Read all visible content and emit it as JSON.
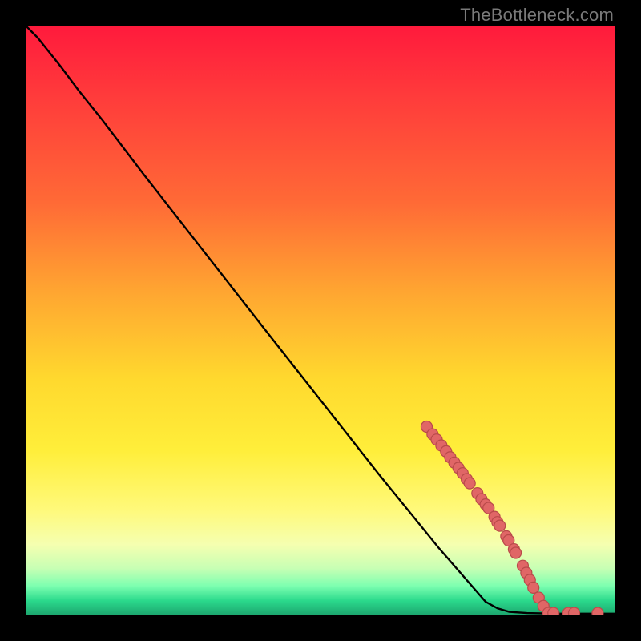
{
  "watermark": "TheBottleneck.com",
  "chart_data": {
    "type": "line",
    "title": "",
    "xlabel": "",
    "ylabel": "",
    "xlim": [
      0,
      1
    ],
    "ylim": [
      0,
      1
    ],
    "note": "Axes are unlabeled in the source image; x and y are normalized 0–1 within the plot frame. y=1 is the top edge, y=0 is the bottom edge.",
    "curve": [
      {
        "x": 0.0,
        "y": 1.0
      },
      {
        "x": 0.02,
        "y": 0.98
      },
      {
        "x": 0.04,
        "y": 0.955
      },
      {
        "x": 0.06,
        "y": 0.93
      },
      {
        "x": 0.09,
        "y": 0.89
      },
      {
        "x": 0.13,
        "y": 0.84
      },
      {
        "x": 0.2,
        "y": 0.748
      },
      {
        "x": 0.3,
        "y": 0.62
      },
      {
        "x": 0.4,
        "y": 0.492
      },
      {
        "x": 0.5,
        "y": 0.365
      },
      {
        "x": 0.6,
        "y": 0.238
      },
      {
        "x": 0.7,
        "y": 0.115
      },
      {
        "x": 0.78,
        "y": 0.023
      },
      {
        "x": 0.8,
        "y": 0.012
      },
      {
        "x": 0.82,
        "y": 0.006
      },
      {
        "x": 0.85,
        "y": 0.004
      },
      {
        "x": 0.9,
        "y": 0.003
      },
      {
        "x": 1.0,
        "y": 0.003
      }
    ],
    "markers": [
      {
        "x": 0.68,
        "y": 0.32
      },
      {
        "x": 0.69,
        "y": 0.307
      },
      {
        "x": 0.697,
        "y": 0.298
      },
      {
        "x": 0.705,
        "y": 0.288
      },
      {
        "x": 0.713,
        "y": 0.278
      },
      {
        "x": 0.72,
        "y": 0.268
      },
      {
        "x": 0.727,
        "y": 0.259
      },
      {
        "x": 0.734,
        "y": 0.25
      },
      {
        "x": 0.741,
        "y": 0.241
      },
      {
        "x": 0.748,
        "y": 0.231
      },
      {
        "x": 0.753,
        "y": 0.224
      },
      {
        "x": 0.766,
        "y": 0.207
      },
      {
        "x": 0.773,
        "y": 0.197
      },
      {
        "x": 0.78,
        "y": 0.188
      },
      {
        "x": 0.785,
        "y": 0.182
      },
      {
        "x": 0.795,
        "y": 0.167
      },
      {
        "x": 0.8,
        "y": 0.158
      },
      {
        "x": 0.804,
        "y": 0.152
      },
      {
        "x": 0.815,
        "y": 0.134
      },
      {
        "x": 0.819,
        "y": 0.127
      },
      {
        "x": 0.828,
        "y": 0.112
      },
      {
        "x": 0.831,
        "y": 0.106
      },
      {
        "x": 0.843,
        "y": 0.084
      },
      {
        "x": 0.849,
        "y": 0.072
      },
      {
        "x": 0.855,
        "y": 0.06
      },
      {
        "x": 0.861,
        "y": 0.047
      },
      {
        "x": 0.87,
        "y": 0.03
      },
      {
        "x": 0.878,
        "y": 0.016
      },
      {
        "x": 0.886,
        "y": 0.004
      },
      {
        "x": 0.895,
        "y": 0.004
      },
      {
        "x": 0.92,
        "y": 0.004
      },
      {
        "x": 0.93,
        "y": 0.004
      },
      {
        "x": 0.97,
        "y": 0.004
      }
    ],
    "colors": {
      "curve": "#000000",
      "marker_fill": "#e06666",
      "marker_stroke": "#b94a4a",
      "background_top": "#ff1a3c",
      "background_bottom": "#1ca56e"
    },
    "marker_radius_px": 7
  }
}
